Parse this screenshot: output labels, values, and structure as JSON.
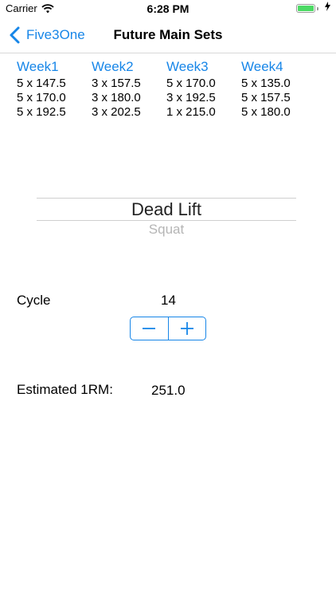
{
  "status_bar": {
    "carrier": "Carrier",
    "time": "6:28 PM",
    "battery_level": 1.0
  },
  "nav": {
    "back_label": "Five3One",
    "title": "Future Main Sets"
  },
  "colors": {
    "accent": "#1786e8",
    "battery": "#4cd964"
  },
  "weeks": [
    {
      "label": "Week1",
      "sets": [
        "5 x 147.5",
        "5 x 170.0",
        "5 x 192.5"
      ]
    },
    {
      "label": "Week2",
      "sets": [
        "3 x 157.5",
        "3 x 180.0",
        "3 x 202.5"
      ]
    },
    {
      "label": "Week3",
      "sets": [
        "5 x 170.0",
        "3 x 192.5",
        "1 x 215.0"
      ]
    },
    {
      "label": "Week4",
      "sets": [
        "5 x 135.0",
        "5 x 157.5",
        "5 x 180.0"
      ]
    }
  ],
  "picker": {
    "selected": "Dead Lift",
    "next": "Squat"
  },
  "cycle": {
    "label": "Cycle",
    "value": "14"
  },
  "estimated_1rm": {
    "label": "Estimated 1RM:",
    "value": "251.0"
  },
  "icons": {
    "back": "chevron-left-icon",
    "wifi": "wifi-icon",
    "battery": "battery-icon",
    "charging": "bolt-icon",
    "decrement": "minus-icon",
    "increment": "plus-icon"
  }
}
